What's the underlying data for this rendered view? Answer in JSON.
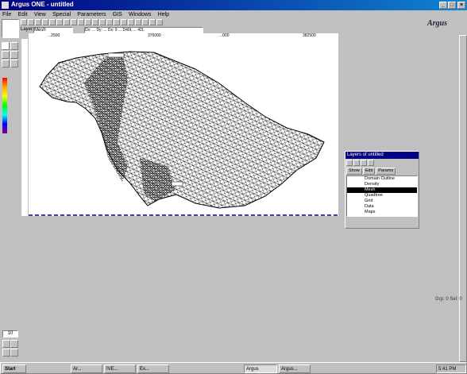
{
  "window": {
    "title": "Argus ONE - untitled",
    "min": "_",
    "max": "□",
    "close": "×"
  },
  "menu": [
    "File",
    "Edit",
    "View",
    "Special",
    "Parameters",
    "GIS",
    "Windows",
    "Help"
  ],
  "layer_field": {
    "label": "Layer:",
    "value": "Mesh",
    "coords": "Dx: ...  Dy: ... Dx: 9 ... D40L ... 42L"
  },
  "logo": "Argus",
  "ruler_ticks": [
    "...2500",
    "375000",
    "...000",
    "382500"
  ],
  "left_tools": {
    "zoom_value": "10"
  },
  "layers_panel": {
    "title": "Layers of untitled",
    "tabs": [
      "Show",
      "Edit",
      "Params"
    ],
    "rows": [
      {
        "label": "Domain Outline",
        "selected": false
      },
      {
        "label": "Density",
        "selected": false
      },
      {
        "label": "Mesh",
        "selected": true
      },
      {
        "label": "Quadtree",
        "selected": false
      },
      {
        "label": "Grid",
        "selected": false
      },
      {
        "label": "Data",
        "selected": false
      },
      {
        "label": "Maps",
        "selected": false
      }
    ]
  },
  "status_text": "Grp: 0 Sel: 0",
  "taskbar": {
    "start": "Start",
    "tasks": [
      "Ar...",
      "IVE...",
      "Ex...",
      "Argus",
      "Argus..."
    ],
    "clock": "5:41 PM"
  },
  "mesh_color": "#000000",
  "accent_title": "#000080"
}
